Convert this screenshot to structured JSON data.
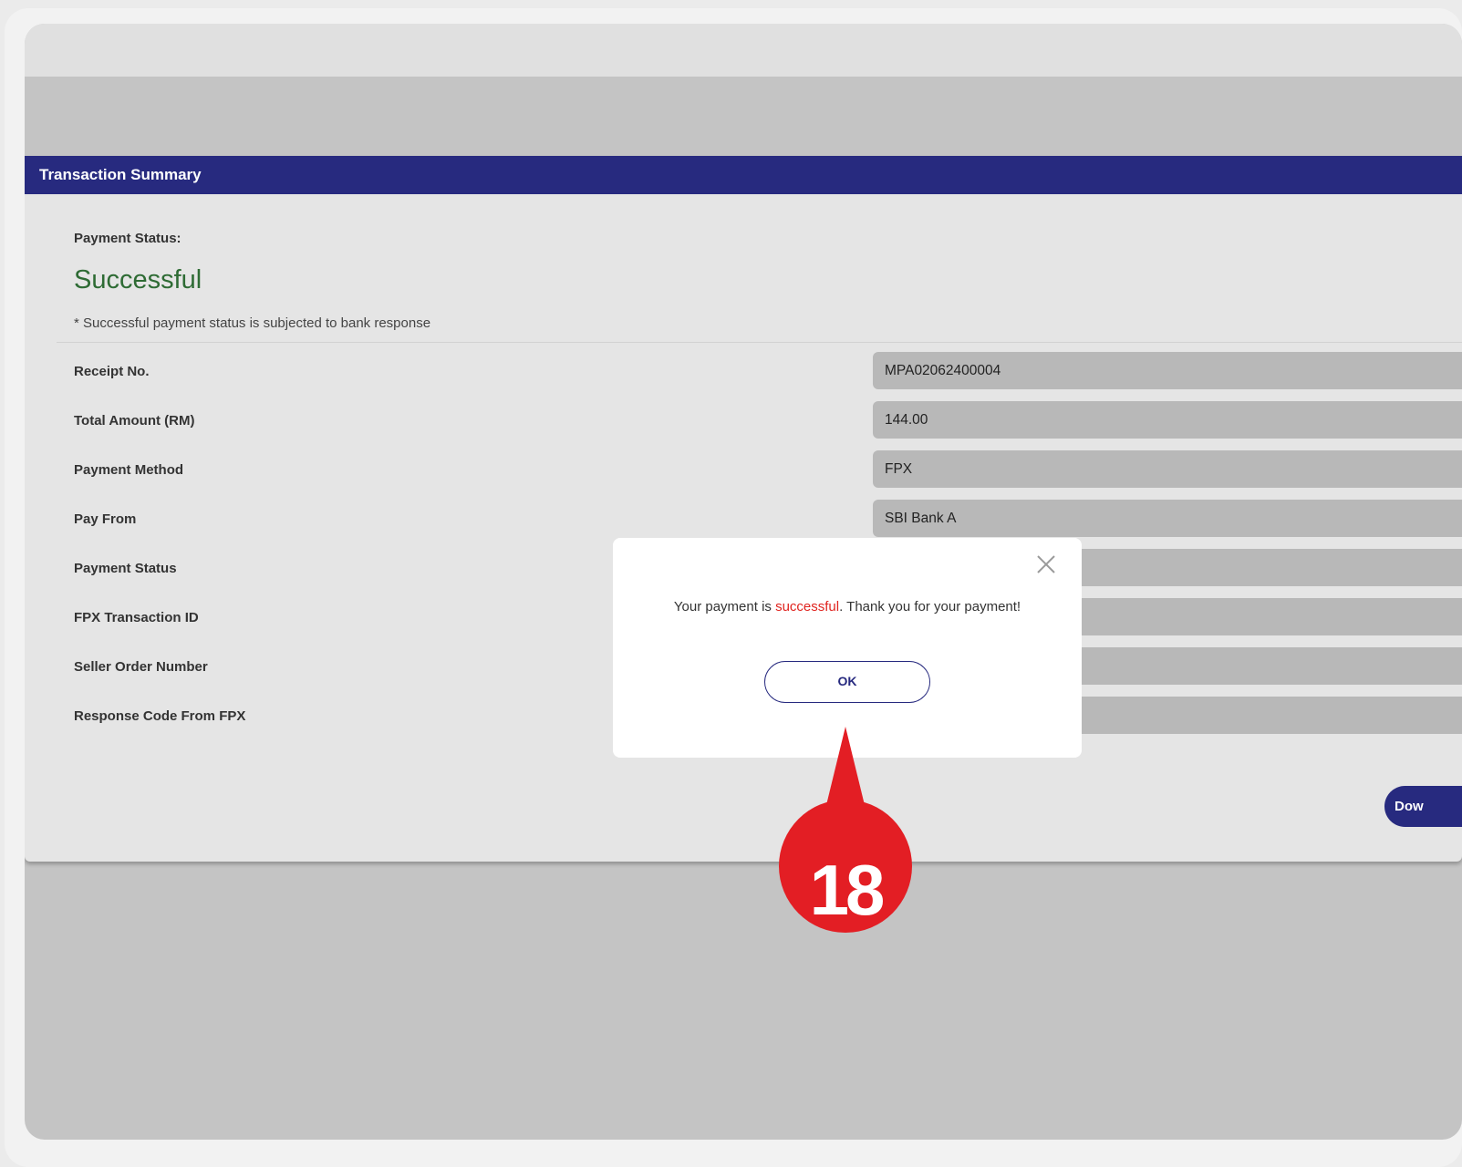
{
  "card": {
    "title": "Transaction Summary",
    "status_caption": "Payment Status:",
    "status_value": "Successful",
    "status_note": "* Successful payment status is subjected to bank response"
  },
  "rows": [
    {
      "label": "Receipt No.",
      "value": "MPA02062400004"
    },
    {
      "label": "Total Amount (RM)",
      "value": "144.00"
    },
    {
      "label": "Payment Method",
      "value": "FPX"
    },
    {
      "label": "Pay From",
      "value": "SBI Bank A"
    },
    {
      "label": "Payment Status",
      "value": ""
    },
    {
      "label": "FPX Transaction ID",
      "value": ""
    },
    {
      "label": "Seller Order Number",
      "value": ""
    },
    {
      "label": "Response Code From FPX",
      "value": ""
    }
  ],
  "download_button": {
    "label": "Dow"
  },
  "modal": {
    "message_prefix": "Your payment is ",
    "message_highlight": "successful",
    "message_suffix": ". Thank you for your payment!",
    "ok_label": "OK"
  },
  "callout": {
    "number": "18"
  },
  "colors": {
    "header_bg": "#272a7f",
    "success_text": "#2e6b34",
    "highlight_red": "#e0241f",
    "callout_red": "#e31e24"
  },
  "icons": {
    "close": "close-icon"
  }
}
